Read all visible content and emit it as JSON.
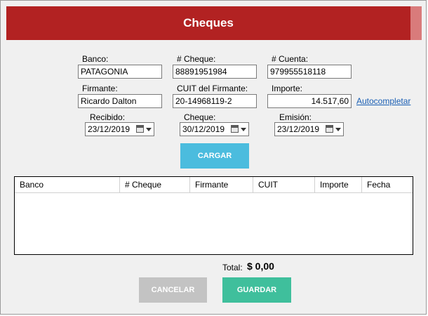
{
  "window": {
    "title": "Cheques"
  },
  "form": {
    "banco": {
      "label": "Banco:",
      "value": "PATAGONIA"
    },
    "numero_cheque": {
      "label": "# Cheque:",
      "value": "88891951984"
    },
    "numero_cuenta": {
      "label": "# Cuenta:",
      "value": "979955518118"
    },
    "firmante": {
      "label": "Firmante:",
      "value": "Ricardo Dalton"
    },
    "cuit_firmante": {
      "label": "CUIT del Firmante:",
      "value": "20-14968119-2"
    },
    "importe": {
      "label": "Importe:",
      "value": "14.517,60"
    },
    "autocompletar_link": "Autocompletar",
    "recibido": {
      "label": "Recibido:",
      "value": "23/12/2019"
    },
    "cheque_fecha": {
      "label": "Cheque:",
      "value": "30/12/2019"
    },
    "emision": {
      "label": "Emisión:",
      "value": "23/12/2019"
    }
  },
  "buttons": {
    "cargar": "CARGAR",
    "cancelar": "CANCELAR",
    "guardar": "GUARDAR"
  },
  "table": {
    "columns": [
      "Banco",
      "# Cheque",
      "Firmante",
      "CUIT",
      "Importe",
      "Fecha"
    ],
    "rows": []
  },
  "total": {
    "label": "Total:",
    "value": "$ 0,00"
  },
  "colors": {
    "title_bar": "#b22222",
    "cargar_button": "#4bbcde",
    "cancelar_button": "#c3c3c3",
    "guardar_button": "#3fbf9c",
    "link": "#1a5fb4"
  },
  "icons": {
    "date_picker": "calendar-icon",
    "dropdown": "chevron-down-icon"
  }
}
